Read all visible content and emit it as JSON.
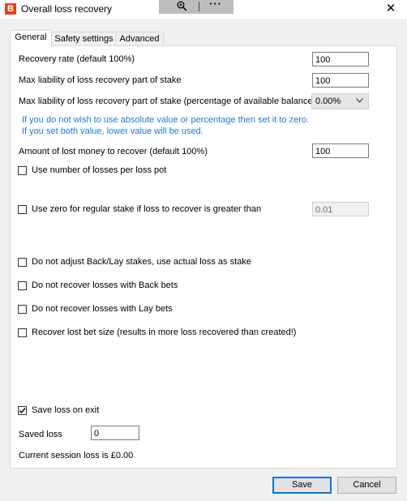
{
  "window": {
    "title": "Overall loss recovery",
    "app_icon_glyph": "B",
    "app_icon_color": "#e8401c",
    "close_glyph": "✕",
    "toolbar": {
      "zoom_icon_glyph": "🔍",
      "more_glyph": "···"
    }
  },
  "tabs": [
    {
      "label": "General",
      "active": true
    },
    {
      "label": "Safety settings",
      "active": false
    },
    {
      "label": "Advanced",
      "active": false
    }
  ],
  "general": {
    "recovery_rate": {
      "label": "Recovery rate (default 100%)",
      "value": "100"
    },
    "max_liability": {
      "label": "Max liability of loss recovery part of stake",
      "value": "100"
    },
    "max_liability_pct": {
      "label": "Max liability of loss recovery part of stake (percentage of available balance)",
      "value": "0.00%"
    },
    "note_line1": "If you do not wish to use absolute value or percentage then set it to zero.",
    "note_line2": "If you set both value, lower value will be used.",
    "note_color": "#1e7ad6",
    "amount_lost": {
      "label": "Amount of lost money to recover (default 100%)",
      "value": "100"
    },
    "checkboxes": {
      "losses_per_pot": {
        "label": "Use number of losses per loss pot",
        "checked": false
      },
      "zero_regular_stake": {
        "label": "Use zero for regular stake if loss to recover is greater than",
        "checked": false,
        "value": "0.01"
      },
      "no_adjust": {
        "label": "Do not adjust Back/Lay stakes, use actual loss as stake",
        "checked": false
      },
      "no_recover_back": {
        "label": "Do not recover losses with Back bets",
        "checked": false
      },
      "no_recover_lay": {
        "label": "Do not recover losses with Lay bets",
        "checked": false
      },
      "recover_bet_size": {
        "label": "Recover lost bet size (results in more loss recovered than created!)",
        "checked": false
      },
      "save_on_exit": {
        "label": "Save loss on exit",
        "checked": true
      }
    },
    "saved_loss": {
      "label": "Saved loss",
      "value": "0"
    },
    "session_loss": "Current session loss is £0.00"
  },
  "buttons": {
    "save": "Save",
    "cancel": "Cancel"
  }
}
